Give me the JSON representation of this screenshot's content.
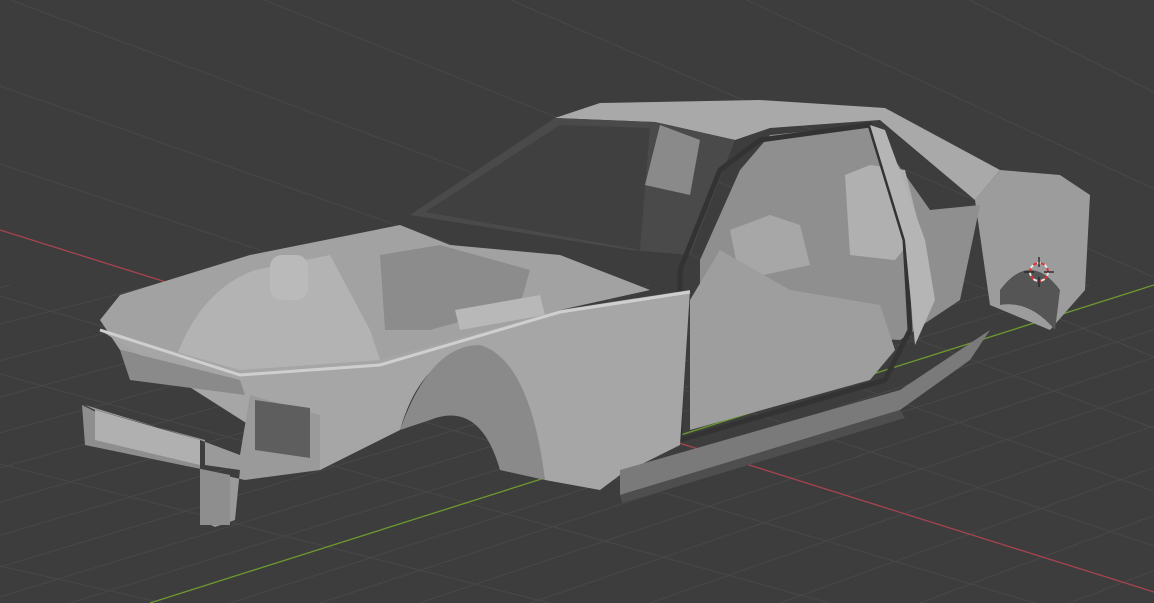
{
  "viewport": {
    "mode": "3d-viewport-solid-shading",
    "colors": {
      "background": "#3d3d3d",
      "grid": "#484848",
      "x_axis": "#a8434f",
      "y_axis": "#6c9a2f",
      "mesh": "#a3a3a3",
      "mesh_shadow": "#6e6e6e",
      "mesh_highlight": "#bdbdbd"
    },
    "icons": {
      "cursor": "3d-cursor-icon"
    }
  }
}
